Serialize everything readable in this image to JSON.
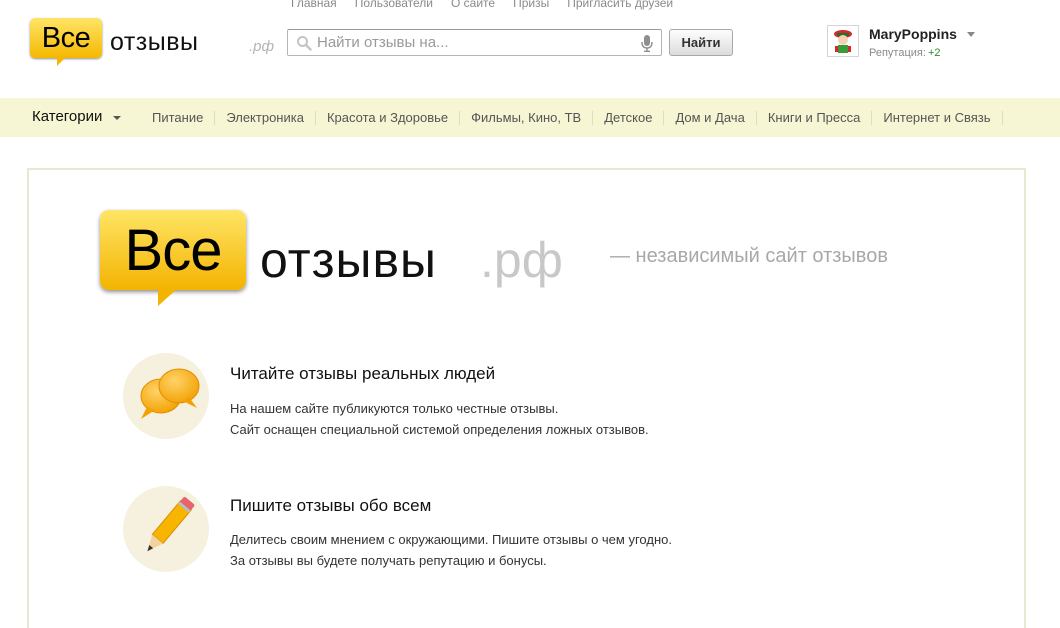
{
  "top_nav": [
    "Главная",
    "Пользователи",
    "О сайте",
    "Призы",
    "Пригласить друзей"
  ],
  "header": {
    "logo_badge": "Все",
    "logo_word": "отзывы",
    "logo_tld": ".рф",
    "search_placeholder": "Найти отзывы на...",
    "search_button": "Найти"
  },
  "user": {
    "name": "MaryPoppins",
    "reputation_label": "Репутация:",
    "reputation_value": "+2"
  },
  "categories": {
    "title": "Категории",
    "items": [
      "Питание",
      "Электроника",
      "Красота и Здоровье",
      "Фильмы, Кино, ТВ",
      "Детское",
      "Дом и Дача",
      "Книги и Пресса",
      "Интернет и Связь"
    ]
  },
  "hero": {
    "logo_badge": "Все",
    "logo_word": "отзывы",
    "logo_tld": ".рф",
    "tagline": "— независимый сайт отзывов"
  },
  "features": [
    {
      "icon": "speech-bubbles-icon",
      "title": "Читайте отзывы реальных людей",
      "lines": [
        "На нашем сайте публикуются только честные отзывы.",
        "Сайт оснащен специальной системой определения ложных отзывов."
      ]
    },
    {
      "icon": "pencil-icon",
      "title": "Пишите отзывы обо всем",
      "lines": [
        "Делитесь своим мнением с окружающими. Пишите отзывы о чем угодно.",
        "За отзывы вы будете получать репутацию и бонусы."
      ]
    }
  ],
  "colors": {
    "brand_yellow": "#f5b800",
    "category_bar": "#f6f6d4",
    "feature_circle": "#f6f1de",
    "reputation_green": "#2e8b2e"
  }
}
